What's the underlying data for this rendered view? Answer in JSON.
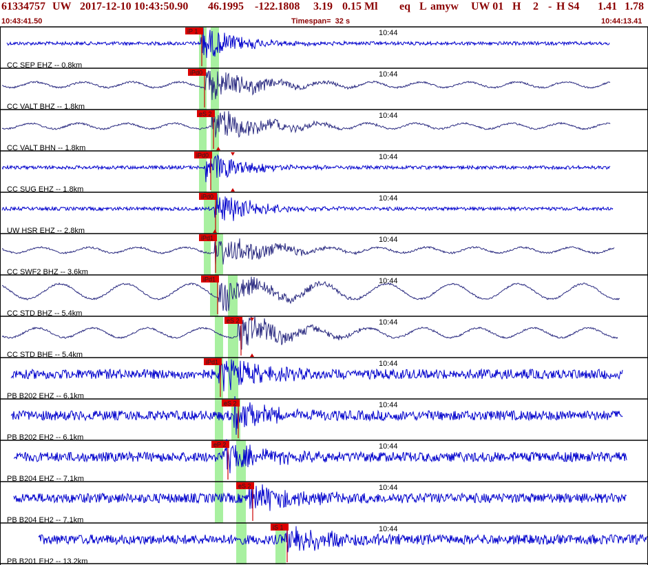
{
  "header": {
    "event_id": "61334757",
    "network": "UW",
    "origin": "2017-12-10 10:43:50.90",
    "lat": "46.1995",
    "lon": "-122.1808",
    "depth": "3.19",
    "magnitude": "0.15 Ml",
    "type": "eq",
    "flags": "L",
    "analyst": "amyw",
    "source": "UW 01",
    "quality": "H",
    "count": "2",
    "dash": "-",
    "hsource": "H S4",
    "rms": "1.41",
    "err": "1.78",
    "start_time": "10:43:41.50",
    "timespan": "Timespan=  32 s",
    "end_time": "10:44:13.41"
  },
  "colors": {
    "frame": "#000000",
    "pick_box": "#dd0000",
    "pick_line": "#cc0000",
    "window_band": "#a8f0a0",
    "trace_broadband": "#2a2a80",
    "trace_blue": "#0000cc",
    "header_text": "#8b0000"
  },
  "chart_data": {
    "type": "line",
    "x_unit": "time",
    "x_start": "10:43:41.50",
    "x_end": "10:44:13.41",
    "tick_label": "10:44",
    "panels": [
      {
        "label": "CC SEP EHZ -- 0.8km",
        "color": "trace_blue",
        "picks": [
          {
            "label": "iP 1",
            "phase": "P"
          }
        ],
        "markers": [],
        "bands": [
          1
        ]
      },
      {
        "label": "CC VALT BHZ -- 1.8km",
        "color": "trace_broadband",
        "picks": [
          {
            "label": "iPd0",
            "phase": "P"
          }
        ],
        "markers": [],
        "bands": [
          1
        ]
      },
      {
        "label": "CC VALT BHN -- 1.8km",
        "color": "trace_broadband",
        "picks": [
          {
            "label": "eS 2",
            "phase": "S"
          }
        ],
        "markers": [
          "bottom"
        ],
        "bands": [
          1
        ]
      },
      {
        "label": "CC SUG EHZ -- 1.8km",
        "color": "trace_blue",
        "picks": [
          {
            "label": "iPd0",
            "phase": "P"
          }
        ],
        "markers": [
          "top",
          "bottom"
        ],
        "bands": [
          1
        ]
      },
      {
        "label": "UW HSR EHZ -- 2.8km",
        "color": "trace_blue",
        "picks": [
          {
            "label": "iPd0",
            "phase": "P"
          }
        ],
        "markers": [
          "bottom"
        ],
        "bands": [
          1
        ]
      },
      {
        "label": "CC SWF2 BHZ -- 3.6km",
        "color": "trace_broadband",
        "picks": [
          {
            "label": "iPd1",
            "phase": "P"
          }
        ],
        "markers": [],
        "bands": [
          1
        ]
      },
      {
        "label": "CC STD BHZ -- 5.4km",
        "color": "trace_broadband",
        "picks": [
          {
            "label": "iPd1",
            "phase": "P"
          }
        ],
        "markers": [],
        "bands": [
          1,
          2
        ]
      },
      {
        "label": "CC STD BHE -- 5.4km",
        "color": "trace_broadband",
        "picks": [
          {
            "label": "eS 2",
            "phase": "S"
          }
        ],
        "markers": [
          "top",
          "bottom"
        ],
        "bands": [
          1,
          2
        ]
      },
      {
        "label": "PB B202 EHZ -- 6.1km",
        "color": "trace_blue",
        "picks": [
          {
            "label": "iPd1",
            "phase": "P"
          }
        ],
        "markers": [],
        "bands": [
          1,
          2
        ]
      },
      {
        "label": "PB B202 EH2 -- 6.1km",
        "color": "trace_blue",
        "picks": [
          {
            "label": "eS 2",
            "phase": "S"
          }
        ],
        "markers": [],
        "bands": [
          1,
          2
        ]
      },
      {
        "label": "PB B204 EHZ -- 7.1km",
        "color": "trace_blue",
        "picks": [
          {
            "label": "eP 2",
            "phase": "P"
          }
        ],
        "markers": [],
        "bands": [
          1,
          2
        ]
      },
      {
        "label": "PB B204 EH2 -- 7.1km",
        "color": "trace_blue",
        "picks": [
          {
            "label": "eS 2",
            "phase": "S"
          }
        ],
        "markers": [],
        "bands": [
          1,
          2
        ]
      },
      {
        "label": "PB B201 EH2 -- 13.2km",
        "color": "trace_blue",
        "picks": [
          {
            "label": "iS 1",
            "phase": "S"
          }
        ],
        "markers": [],
        "bands": [
          1,
          2
        ]
      }
    ]
  }
}
